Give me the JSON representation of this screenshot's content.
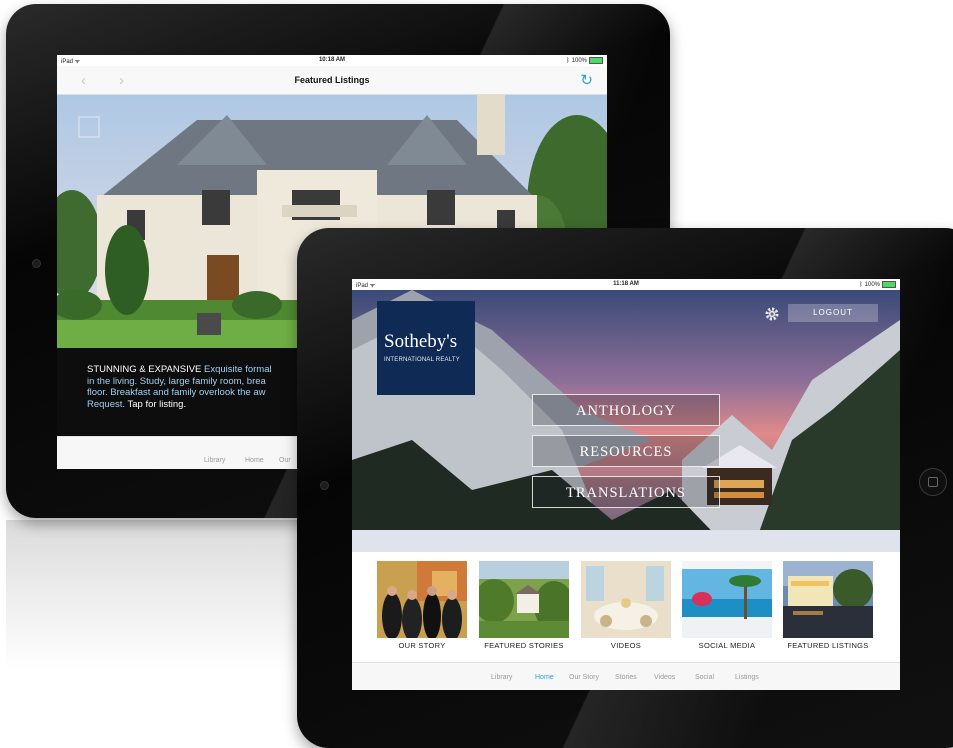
{
  "back_ipad": {
    "status": {
      "carrier": "iPad",
      "time": "10:18 AM",
      "battery": "100%"
    },
    "nav": {
      "title": "Featured Listings"
    },
    "caption": {
      "headline": "STUNNING & EXPANSIVE",
      "line1_rest": " Exquisite formal",
      "line2": "in the living. Study, large family room, brea",
      "line3": "floor. Breakfast and family overlook the aw",
      "line4_link": "Request.",
      "line4_rest": " Tap for listing."
    },
    "tabs": [
      "Library",
      "Home",
      "Our"
    ]
  },
  "front_ipad": {
    "status": {
      "carrier": "iPad",
      "time": "11:18 AM",
      "battery": "100%"
    },
    "logo": {
      "name": "Sotheby's",
      "sub": "INTERNATIONAL REALTY"
    },
    "logout_label": "LOGOUT",
    "menu": [
      "ANTHOLOGY",
      "RESOURCES",
      "TRANSLATIONS"
    ],
    "thumbs": [
      "OUR STORY",
      "FEATURED STORIES",
      "VIDEOS",
      "SOCIAL MEDIA",
      "FEATURED LISTINGS"
    ],
    "tabs": [
      "Library",
      "Home",
      "Our Story",
      "Stories",
      "Videos",
      "Social",
      "Listings"
    ],
    "active_tab": "Home"
  },
  "colors": {
    "accent": "#2aa3d8",
    "logo_bg": "#0f2a55",
    "battery": "#4cd964"
  }
}
